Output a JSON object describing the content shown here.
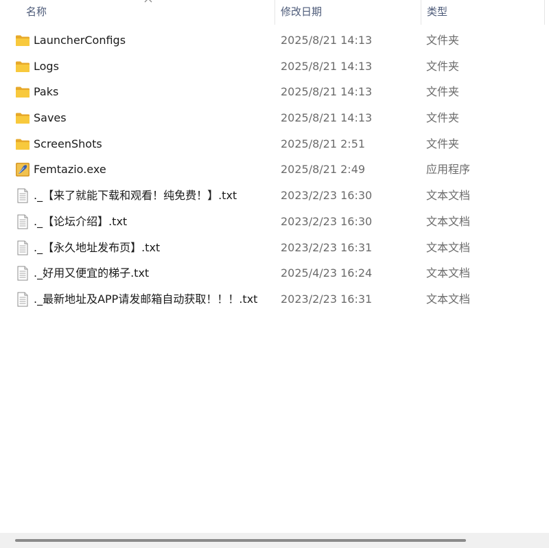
{
  "columns": {
    "name": "名称",
    "date": "修改日期",
    "type": "类型"
  },
  "sort_indicator_icon": "chevron-up-icon",
  "files": [
    {
      "name": "LauncherConfigs",
      "date": "2025/8/21 14:13",
      "type": "文件夹",
      "icon": "folder-icon"
    },
    {
      "name": "Logs",
      "date": "2025/8/21 14:13",
      "type": "文件夹",
      "icon": "folder-icon"
    },
    {
      "name": "Paks",
      "date": "2025/8/21 14:13",
      "type": "文件夹",
      "icon": "folder-icon"
    },
    {
      "name": "Saves",
      "date": "2025/8/21 14:13",
      "type": "文件夹",
      "icon": "folder-icon"
    },
    {
      "name": "ScreenShots",
      "date": "2025/8/21 2:51",
      "type": "文件夹",
      "icon": "folder-icon"
    },
    {
      "name": "Femtazio.exe",
      "date": "2025/8/21 2:49",
      "type": "应用程序",
      "icon": "app-icon"
    },
    {
      "name": "._【来了就能下载和观看！纯免费！】.txt",
      "date": "2023/2/23 16:30",
      "type": "文本文档",
      "icon": "text-file-icon"
    },
    {
      "name": "._【论坛介绍】.txt",
      "date": "2023/2/23 16:30",
      "type": "文本文档",
      "icon": "text-file-icon"
    },
    {
      "name": "._【永久地址发布页】.txt",
      "date": "2023/2/23 16:31",
      "type": "文本文档",
      "icon": "text-file-icon"
    },
    {
      "name": "._好用又便宜的梯子.txt",
      "date": "2025/4/23 16:24",
      "type": "文本文档",
      "icon": "text-file-icon"
    },
    {
      "name": "._最新地址及APP请发邮箱自动获取！！！.txt",
      "date": "2023/2/23 16:31",
      "type": "文本文档",
      "icon": "text-file-icon"
    }
  ],
  "colors": {
    "folder": "#f8c93d",
    "header_text": "#4c5a78",
    "secondary_text": "#6b6b6b",
    "scrollbar_track": "#f0f0f0",
    "scrollbar_thumb": "#8a8a8a"
  }
}
